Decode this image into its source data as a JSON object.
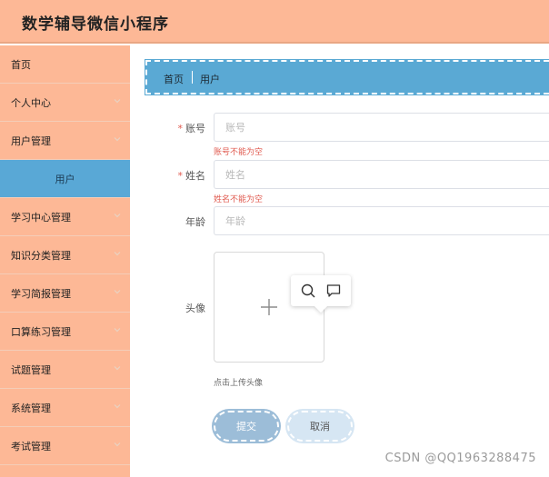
{
  "app": {
    "title": "数学辅导微信小程序"
  },
  "sidebar": {
    "items": [
      {
        "label": "首页",
        "has_chevron": false
      },
      {
        "label": "个人中心",
        "has_chevron": true
      },
      {
        "label": "用户管理",
        "has_chevron": true
      },
      {
        "label": "用户",
        "has_chevron": false,
        "submenu": true,
        "active": true
      },
      {
        "label": "学习中心管理",
        "has_chevron": true
      },
      {
        "label": "知识分类管理",
        "has_chevron": true
      },
      {
        "label": "学习简报管理",
        "has_chevron": true
      },
      {
        "label": "口算练习管理",
        "has_chevron": true
      },
      {
        "label": "试题管理",
        "has_chevron": true
      },
      {
        "label": "系统管理",
        "has_chevron": true
      },
      {
        "label": "考试管理",
        "has_chevron": true
      }
    ]
  },
  "breadcrumb": {
    "home": "首页",
    "current": "用户"
  },
  "form": {
    "account": {
      "label": "账号",
      "placeholder": "账号",
      "error": "账号不能为空",
      "required": true
    },
    "name": {
      "label": "姓名",
      "placeholder": "姓名",
      "error": "姓名不能为空",
      "required": true
    },
    "age": {
      "label": "年龄",
      "placeholder": "年龄",
      "required": false
    },
    "avatar": {
      "label": "头像",
      "hint": "点击上传头像"
    },
    "submit_label": "提交",
    "cancel_label": "取消"
  },
  "watermark": "CSDN @QQ1963288475",
  "colors": {
    "header_bg": "#fdb896",
    "sidebar_bg": "#fdb896",
    "active_submenu": "#59a8d6",
    "breadcrumb_bg": "#5aa9d4",
    "error": "#e05a4f",
    "submit_bg": "#9cbdd8",
    "cancel_bg": "#d6e6f3"
  },
  "icons": {
    "chevron": "chevron-down-icon",
    "upload": "plus-icon",
    "search": "search-icon",
    "comment": "comment-icon"
  }
}
